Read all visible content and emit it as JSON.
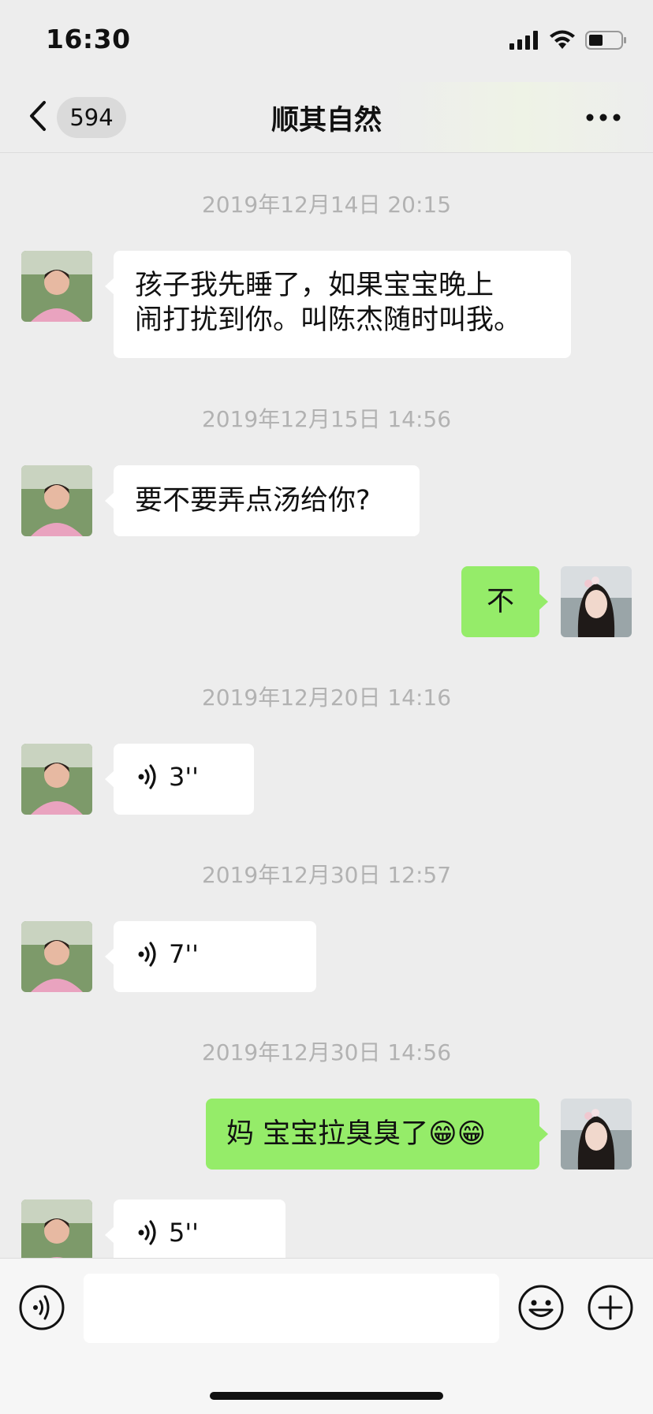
{
  "status_bar": {
    "time": "16:30"
  },
  "nav": {
    "unread_count": "594",
    "title": "顺其自然"
  },
  "messages": [
    {
      "timestamp": "2019年12月14日 20:15",
      "text_line1": "孩子我先睡了，如果宝宝晚上",
      "text_line2": "闹打扰到你。叫陈杰随时叫我。"
    },
    {
      "timestamp": "2019年12月15日 14:56",
      "text": "要不要弄点汤给你?"
    },
    {
      "text": "不"
    },
    {
      "timestamp": "2019年12月20日 14:16",
      "voice_duration": "3''"
    },
    {
      "timestamp": "2019年12月30日 12:57",
      "voice_duration": "7''"
    },
    {
      "timestamp": "2019年12月30日 14:56",
      "text": "妈 宝宝拉臭臭了😁😁"
    },
    {
      "voice_duration": "5''"
    }
  ],
  "colors": {
    "outgoing_bubble": "#95ec69",
    "incoming_bubble": "#ffffff",
    "background": "#ededed"
  },
  "icons": [
    "back-arrow-icon",
    "more-icon",
    "voice-icon",
    "emoji-icon",
    "plus-icon",
    "signal-icon",
    "wifi-icon",
    "battery-icon"
  ]
}
